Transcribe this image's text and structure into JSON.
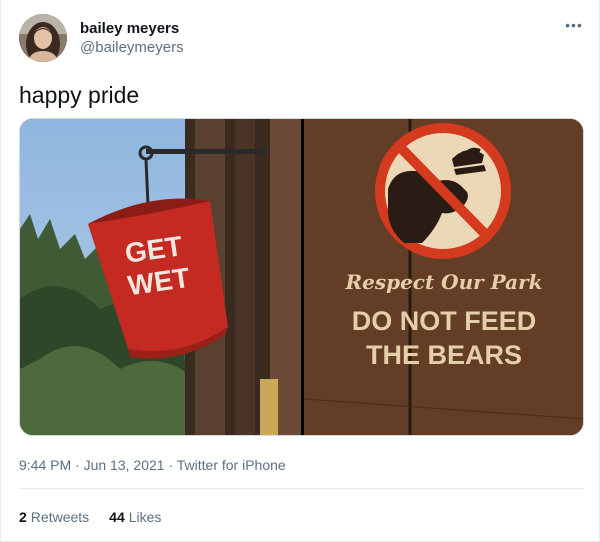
{
  "author": {
    "name": "bailey meyers",
    "handle": "@baileymeyers"
  },
  "tweet": {
    "text": "happy pride"
  },
  "media": {
    "left_sign": {
      "line1": "GET",
      "line2": "WET"
    },
    "right_sign": {
      "line1": "Respect Our Park",
      "line2": "DO NOT FEED",
      "line3": "THE BEARS"
    }
  },
  "meta": {
    "time": "9:44 PM",
    "sep1": " · ",
    "date": "Jun 13, 2021",
    "sep2": " · ",
    "source": "Twitter for iPhone"
  },
  "stats": {
    "retweets_count": "2",
    "retweets_label": "Retweets",
    "likes_count": "44",
    "likes_label": "Likes"
  },
  "more_icon": "more-horizontal-icon"
}
